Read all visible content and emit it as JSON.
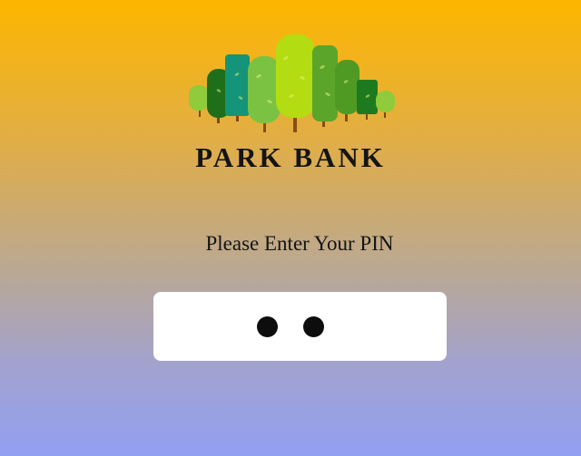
{
  "brand": {
    "name": "PARK BANK",
    "logo": "forest-trees-logo",
    "tree_colors": [
      "#7CC242",
      "#1E7A1E",
      "#149478",
      "#AEE20E",
      "#5BA52A",
      "#2E8B22",
      "#8FCB3A"
    ]
  },
  "pin_screen": {
    "prompt": "Please Enter Your PIN",
    "entered_digits": 2,
    "mask_char": "●"
  },
  "colors": {
    "gradient_top": "#FDB600",
    "gradient_bottom": "#92A0F2",
    "text": "#141414",
    "input_background": "#FFFFFF"
  }
}
